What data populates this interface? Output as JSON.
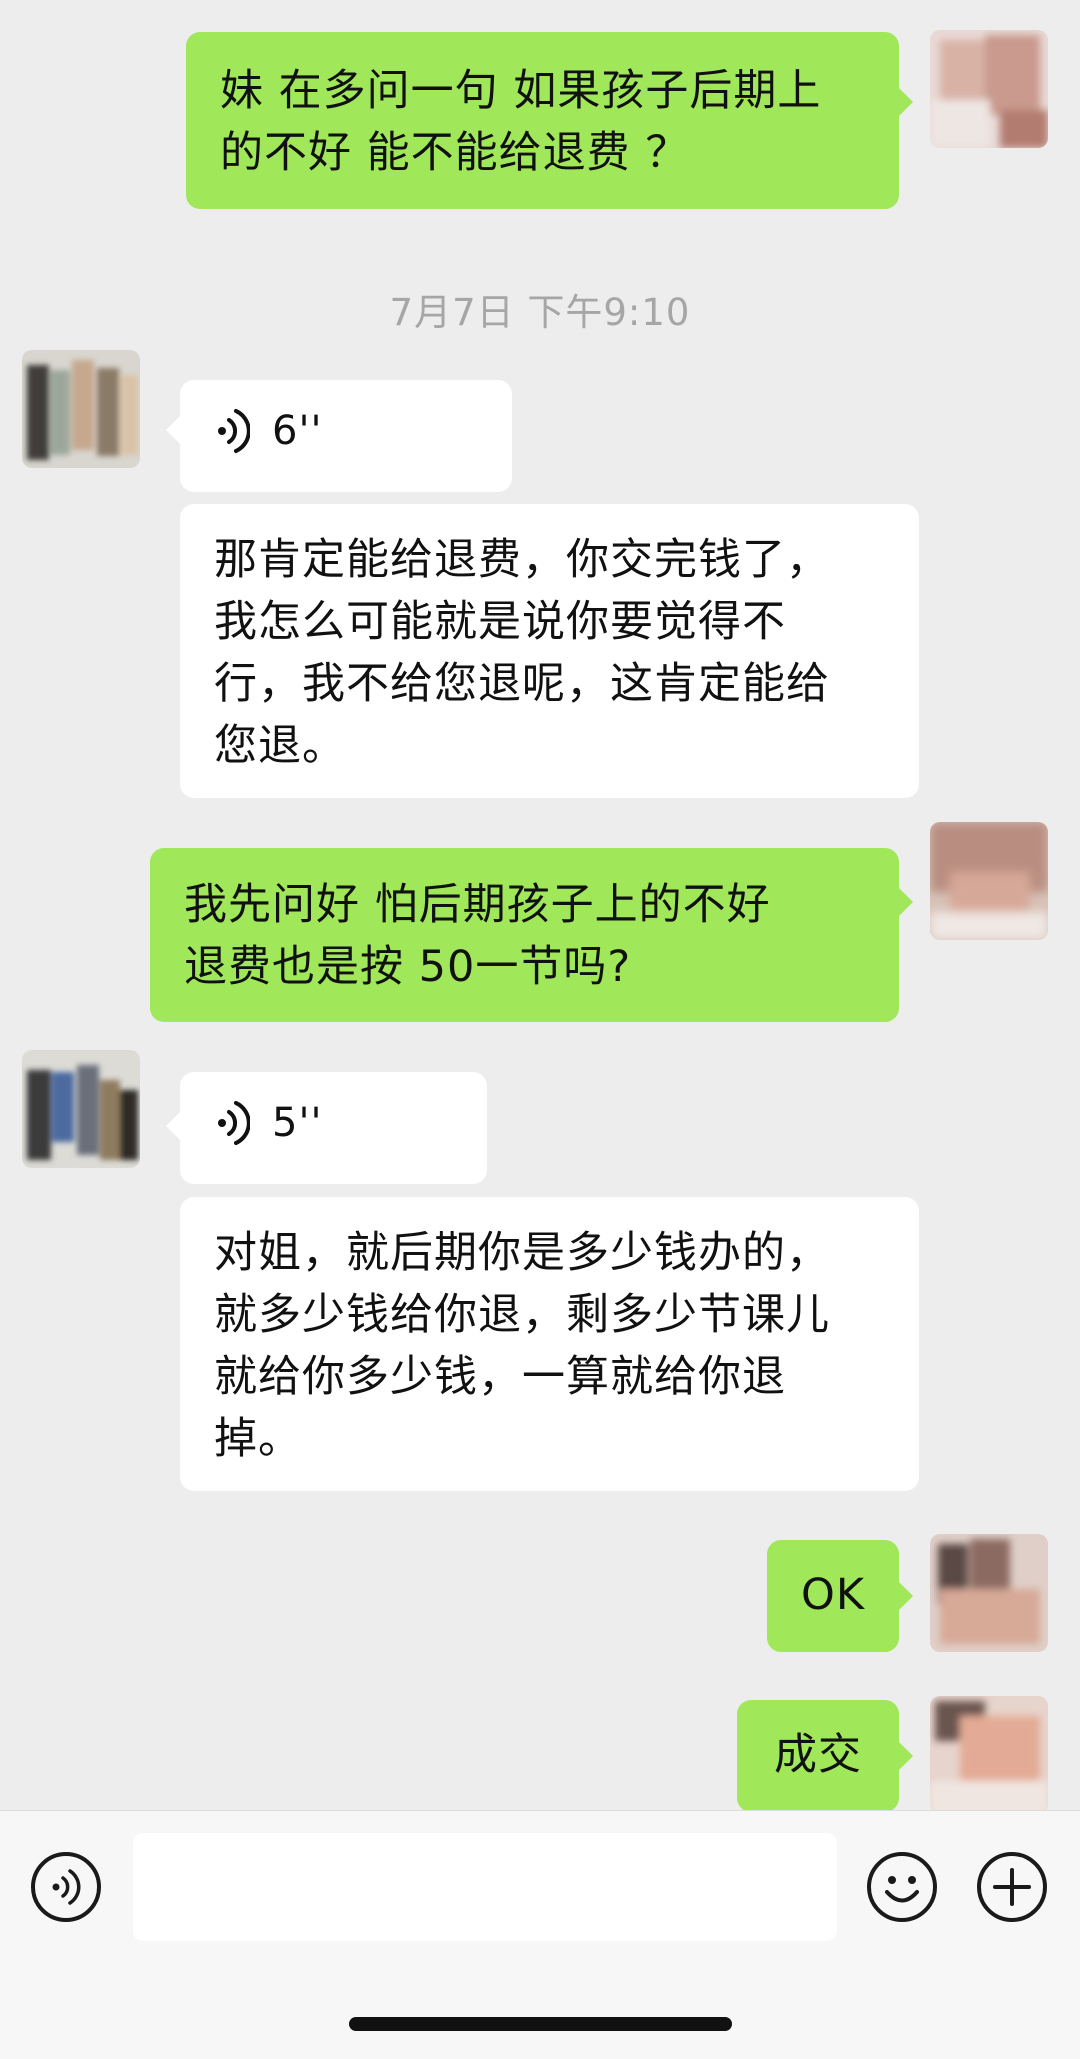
{
  "messages": [
    {
      "side": "out",
      "type": "text",
      "text_lines": [
        "妹 在多问一句 如果孩子后期上",
        "的不好 能不能给退费 ？"
      ]
    },
    {
      "type": "timestamp",
      "text": "7月7日 下午9:10"
    },
    {
      "side": "in",
      "type": "voice",
      "duration": "6''"
    },
    {
      "side": "in",
      "type": "text",
      "text_lines": [
        "那肯定能给退费，你交完钱了，",
        "我怎么可能就是说你要觉得不",
        "行，我不给您退呢，这肯定能给",
        "您退。"
      ]
    },
    {
      "side": "out",
      "type": "text",
      "text_lines": [
        "我先问好 怕后期孩子上的不好",
        "退费也是按 50一节吗?"
      ]
    },
    {
      "side": "in",
      "type": "voice",
      "duration": "5''"
    },
    {
      "side": "in",
      "type": "text",
      "text_lines": [
        "对姐，就后期你是多少钱办的，",
        "就多少钱给你退，剩多少节课儿",
        "就给你多少钱，一算就给你退",
        "掉。"
      ]
    },
    {
      "side": "out",
      "type": "text",
      "text_lines": [
        "OK"
      ]
    },
    {
      "side": "out",
      "type": "text",
      "text_lines": [
        "成交"
      ]
    }
  ],
  "input_bar": {
    "voice_button_icon": "voice-icon",
    "input_value": "",
    "emoji_button_icon": "emoji-icon",
    "more_button_icon": "plus-icon"
  },
  "colors": {
    "outgoing_bubble": "#a0e75a",
    "incoming_bubble": "#ffffff",
    "chat_background": "#ededed",
    "timestamp_text": "#a6a6a6"
  }
}
